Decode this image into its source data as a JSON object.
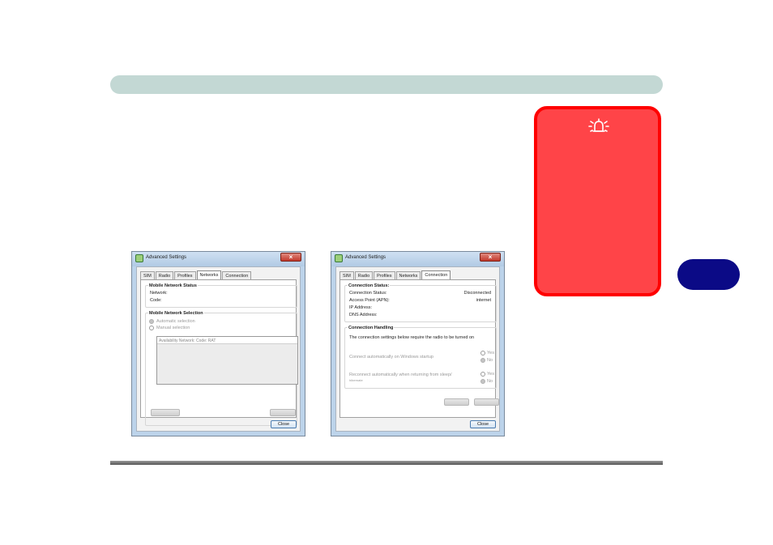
{
  "colors": {
    "header_bar": "#c3d8d4",
    "warning_fill": "#ff4448",
    "warning_border": "#ff0000",
    "chapter_tab": "#0b0a86"
  },
  "warning_box": {
    "icon": "alarm-bell-icon"
  },
  "window_networks": {
    "title": "Advanced Settings",
    "tabs": [
      "SIM",
      "Radio",
      "Profiles",
      "Networks",
      "Connection"
    ],
    "active_tab": "Networks",
    "status_group": {
      "title": "Mobile Network Status",
      "network_label": "Network:",
      "code_label": "Code:"
    },
    "selection_group": {
      "title": "Mobile Network Selection",
      "automatic": "Automatic selection",
      "manual": "Manual selection",
      "list_header": "Availability Network: Code: RAT"
    },
    "close_label": "Close"
  },
  "window_connection": {
    "title": "Advanced Settings",
    "tabs": [
      "SIM",
      "Radio",
      "Profiles",
      "Networks",
      "Connection"
    ],
    "active_tab": "Connection",
    "status_group": {
      "title": "Connection Status:",
      "rows": [
        {
          "label": "Connection Status:",
          "value": "Disconnected"
        },
        {
          "label": "Access Point (APN):",
          "value": "internet"
        },
        {
          "label": "IP Address:",
          "value": ""
        },
        {
          "label": "DNS Address:",
          "value": ""
        }
      ]
    },
    "handling_group": {
      "title": "Connection Handling",
      "note": "The connection settings below require the radio to be turned on",
      "startup_label": "Connect automatically on Windows startup",
      "sleep_label": "Reconnect automatically when returning from sleep/",
      "sleep_sub": "hibernate",
      "yes": "Yes",
      "no": "No"
    },
    "close_label": "Close"
  }
}
